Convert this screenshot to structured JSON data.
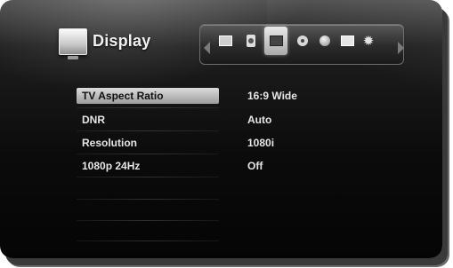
{
  "header": {
    "title": "Display",
    "title_icon": "tv-icon"
  },
  "tabs": [
    {
      "name": "tab-general",
      "icon": "monitor-icon"
    },
    {
      "name": "tab-audio",
      "icon": "speaker-icon"
    },
    {
      "name": "tab-display",
      "icon": "display-icon",
      "selected": true
    },
    {
      "name": "tab-language",
      "icon": "disc-icon"
    },
    {
      "name": "tab-network",
      "icon": "globe-icon"
    },
    {
      "name": "tab-lock",
      "icon": "card-icon"
    },
    {
      "name": "tab-others",
      "icon": "gear-icon"
    }
  ],
  "settings": [
    {
      "label": "TV Aspect Ratio",
      "value": "16:9 Wide",
      "selected": true
    },
    {
      "label": "DNR",
      "value": "Auto"
    },
    {
      "label": "Resolution",
      "value": "1080i"
    },
    {
      "label": "1080p 24Hz",
      "value": "Off"
    }
  ]
}
